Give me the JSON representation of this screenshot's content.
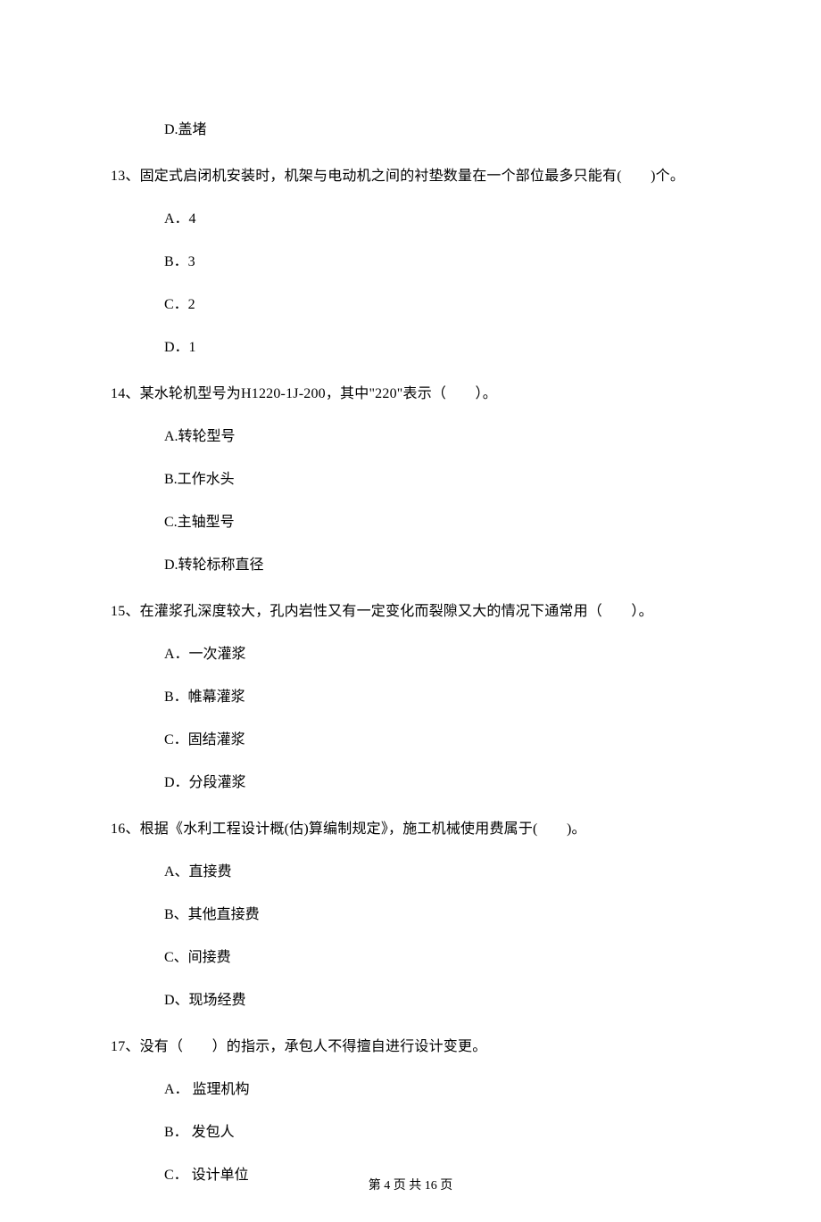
{
  "q12_options": {
    "d": "D.盖堵"
  },
  "q13": {
    "text": "13、固定式启闭机安装时，机架与电动机之间的衬垫数量在一个部位最多只能有(　　)个。",
    "a": "A．4",
    "b": "B．3",
    "c": "C．2",
    "d": "D．1"
  },
  "q14": {
    "text": "14、某水轮机型号为H1220-1J-200，其中\"220\"表示（　　）。",
    "a": "A.转轮型号",
    "b": "B.工作水头",
    "c": "C.主轴型号",
    "d": "D.转轮标称直径"
  },
  "q15": {
    "text": "15、在灌浆孔深度较大，孔内岩性又有一定变化而裂隙又大的情况下通常用（　　）。",
    "a": "A．一次灌浆",
    "b": "B．帷幕灌浆",
    "c": "C．固结灌浆",
    "d": "D．分段灌浆"
  },
  "q16": {
    "text": "16、根据《水利工程设计概(估)算编制规定》，施工机械使用费属于(　　)。",
    "a": "A、直接费",
    "b": "B、其他直接费",
    "c": "C、间接费",
    "d": "D、现场经费"
  },
  "q17": {
    "text": "17、没有（　　）的指示，承包人不得擅自进行设计变更。",
    "a": "A． 监理机构",
    "b": "B． 发包人",
    "c": "C． 设计单位"
  },
  "footer": "第 4 页 共 16 页"
}
